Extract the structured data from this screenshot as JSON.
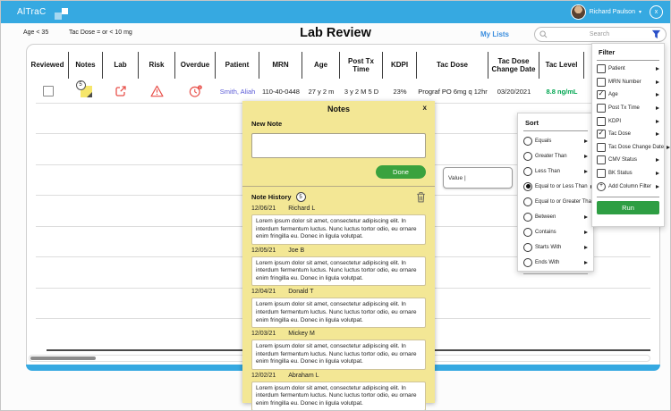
{
  "colors": {
    "accent_blue": "#36A9E1",
    "link_blue": "#3A8DDE",
    "funnel_blue": "#2B50C8",
    "alert_red": "#E8504A",
    "note_yellow": "#F3E795",
    "button_green": "#3AA23E",
    "tac_level_green": "#00A651",
    "patient_link": "#5B5BD6"
  },
  "topbar": {
    "logo": "AlTraC",
    "user_name": "Richard Paulson",
    "user_caret": "▾",
    "close_label": "x"
  },
  "toolbar": {
    "filter_chips": [
      "Age < 35",
      "Tac Dose = or < 10 mg"
    ],
    "title": "Lab Review",
    "my_lists": "My Lists",
    "search_placeholder": "Search"
  },
  "table": {
    "columns": [
      "Reviewed",
      "Notes",
      "Lab",
      "Risk",
      "Overdue",
      "Patient",
      "MRN",
      "Age",
      "Post Tx Time",
      "KDPI",
      "Tac Dose",
      "Tac Dose Change Date",
      "Tac Level"
    ],
    "row": {
      "notes_badge": "5",
      "patient": "Smith, Aliah",
      "mrn": "110-40-0448",
      "age": "27 y 2 m",
      "post_tx_time": "3 y 2 M 5 D",
      "kdpi": "23%",
      "tac_dose": "Prograf PO 6mg q 12hr",
      "tac_dose_change_date": "03/20/2021",
      "tac_level": "8.8 ng/mL"
    }
  },
  "notes_popup": {
    "title": "Notes",
    "close": "x",
    "new_note_label": "New Note",
    "done_label": "Done",
    "history_label": "Note History",
    "history_count": "5",
    "entries": [
      {
        "date": "12/06/21",
        "author": "Richard L",
        "text": "Lorem ipsum dolor sit amet, consectetur adipiscing elit. In interdum fermentum luctus. Nunc luctus tortor odio, eu ornare enim fringilla eu. Donec in ligula volutpat."
      },
      {
        "date": "12/05/21",
        "author": "Joe B",
        "text": "Lorem ipsum dolor sit amet, consectetur adipiscing elit. In interdum fermentum luctus. Nunc luctus tortor odio, eu ornare enim fringilla eu. Donec in ligula volutpat."
      },
      {
        "date": "12/04/21",
        "author": "Donald T",
        "text": "Lorem ipsum dolor sit amet, consectetur adipiscing elit. In interdum fermentum luctus. Nunc luctus tortor odio, eu ornare enim fringilla eu. Donec in ligula volutpat."
      },
      {
        "date": "12/03/21",
        "author": "Mickey M",
        "text": "Lorem ipsum dolor sit amet, consectetur adipiscing elit. In interdum fermentum luctus. Nunc luctus tortor odio, eu ornare enim fringilla eu. Donec in ligula volutpat."
      },
      {
        "date": "12/02/21",
        "author": "Abraham L",
        "text": "Lorem ipsum dolor sit amet, consectetur adipiscing elit. In interdum fermentum luctus. Nunc luctus tortor odio, eu ornare enim fringilla eu. Donec in ligula volutpat."
      }
    ]
  },
  "value_input": {
    "text": "Value |"
  },
  "sort_menu": {
    "title": "Sort",
    "selected_option": "Equal to or Less Than",
    "options": [
      {
        "label": "Equals",
        "selected": false
      },
      {
        "label": "Greater Than",
        "selected": false
      },
      {
        "label": "Less Than",
        "selected": false
      },
      {
        "label": "Equal to or Less Than",
        "selected": true
      },
      {
        "label": "Equal to or Greater Than",
        "selected": false
      },
      {
        "label": "Between",
        "selected": false
      },
      {
        "label": "Contains",
        "selected": false
      },
      {
        "label": "Starts With",
        "selected": false
      },
      {
        "label": "Ends With",
        "selected": false
      }
    ]
  },
  "filter_panel": {
    "title": "Filter",
    "items": [
      {
        "label": "Patient",
        "checked": false
      },
      {
        "label": "MRN Number",
        "checked": false
      },
      {
        "label": "Age",
        "checked": true
      },
      {
        "label": "Post Tx Time",
        "checked": false
      },
      {
        "label": "KDPI",
        "checked": false
      },
      {
        "label": "Tac Dose",
        "checked": true
      },
      {
        "label": "Tac Dose Change Date",
        "checked": false
      },
      {
        "label": "CMV Status",
        "checked": false
      },
      {
        "label": "BK Status",
        "checked": false
      }
    ],
    "add_label": "Add Column Filter",
    "run_label": "Run"
  }
}
